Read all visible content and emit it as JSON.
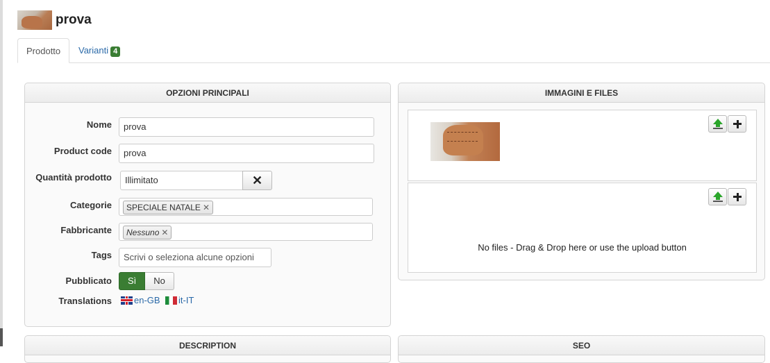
{
  "header": {
    "title": "prova"
  },
  "tabs": [
    {
      "label": "Prodotto"
    },
    {
      "label": "Varianti",
      "badge": "4"
    }
  ],
  "main_options": {
    "title": "OPZIONI PRINCIPALI",
    "fields": {
      "name": {
        "label": "Nome",
        "value": "prova"
      },
      "code": {
        "label": "Product code",
        "value": "prova"
      },
      "quantity": {
        "label": "Quantità prodotto",
        "value": "Illimitato"
      },
      "categories": {
        "label": "Categorie",
        "chips": [
          "SPECIALE NATALE"
        ]
      },
      "manufacturer": {
        "label": "Fabbricante",
        "chips": [
          "Nessuno"
        ]
      },
      "tags": {
        "label": "Tags",
        "placeholder": "Scrivi o seleziona alcune opzioni"
      },
      "published": {
        "label": "Pubblicato",
        "yes": "Sì",
        "no": "No",
        "selected": "yes"
      },
      "translations": {
        "label": "Translations",
        "langs": [
          "en-GB",
          "it-IT"
        ]
      }
    }
  },
  "media": {
    "title": "IMMAGINI E FILES",
    "no_files": "No files - Drag & Drop here or use the upload button"
  },
  "lower_panels": {
    "description": "DESCRIPTION",
    "seo": "SEO"
  },
  "colors": {
    "accent_green": "#3a7d33",
    "link_blue": "#2a69a8"
  }
}
